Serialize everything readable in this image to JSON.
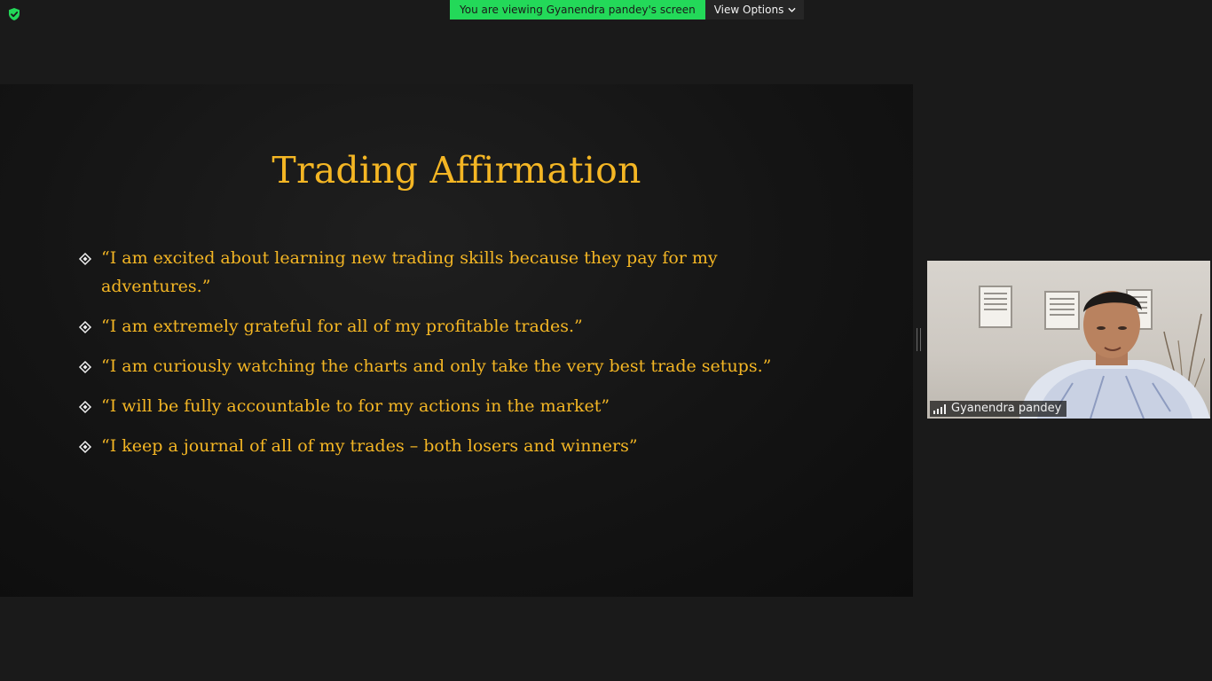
{
  "topbar": {
    "viewing_banner": "You are viewing Gyanendra pandey's screen",
    "view_options_label": "View Options"
  },
  "slide": {
    "title": "Trading Affirmation",
    "bullets": [
      "“I am excited about learning new trading skills because they pay for my adventures.”",
      "“I am extremely grateful for all of my profitable trades.”",
      "“I am curiously watching the charts and only take the very best trade setups.”",
      "“I will be fully accountable to for my actions in the market”",
      "“I keep a journal of all of my trades – both losers and winners”"
    ]
  },
  "participant": {
    "name": "Gyanendra pandey"
  },
  "icons": {
    "security": "shield-check-icon",
    "view_options": "chevron-down-icon",
    "bullet": "diamond-bullet-icon",
    "signal": "signal-strength-icon"
  },
  "colors": {
    "banner_green": "#23d959",
    "title_gold": "#f4b624",
    "background": "#1a1a1a"
  }
}
